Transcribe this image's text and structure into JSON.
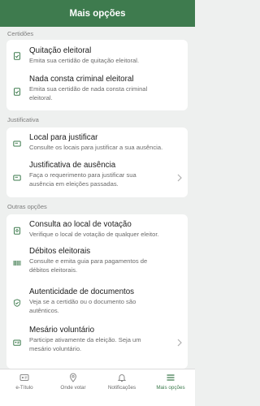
{
  "header": {
    "title": "Mais opções"
  },
  "sections": [
    {
      "label": "Certidões",
      "items": [
        {
          "title": "Quitação eleitoral",
          "icon": "document-check-icon",
          "desc": [
            "Emita sua certidão de quitação eleitoral."
          ]
        },
        {
          "title": "Nada consta criminal eleitoral",
          "icon": "document-check-icon",
          "desc": [
            "Emita sua certidão de nada consta criminal",
            "eleitoral."
          ]
        }
      ]
    },
    {
      "label": "Justificativa",
      "items": [
        {
          "title": "Local para justificar",
          "icon": "message-icon",
          "desc": [
            "Consulte os locais para justificar a sua ausência."
          ]
        },
        {
          "title": "Justificativa de ausência",
          "icon": "message-icon",
          "chevron": true,
          "desc": [
            "Faça o requerimento para justificar sua",
            "ausência em eleições passadas."
          ]
        }
      ]
    },
    {
      "label": "Outras opções",
      "items": [
        {
          "title": "Consulta ao local de votação",
          "icon": "clipboard-location-icon",
          "desc": [
            "Verifique o local de votação de qualquer eleitor."
          ]
        },
        {
          "title": "Débitos eleitorais",
          "icon": "barcode-icon",
          "desc": [
            "Consulte e emita guia para pagamentos de",
            "débitos eleitorais."
          ]
        },
        {
          "title": "Autenticidade de documentos",
          "icon": "shield-check-icon",
          "desc": [
            "Veja se a certidão ou o documento são",
            "autênticos."
          ]
        },
        {
          "title": "Mesário voluntário",
          "icon": "id-card-icon",
          "chevron": true,
          "desc": [
            "Participe ativamente da eleição. Seja um",
            "mesário voluntário."
          ]
        }
      ]
    }
  ],
  "tabbar": [
    {
      "label": "e-Título",
      "icon": "id-card-icon",
      "active": false
    },
    {
      "label": "Onde votar",
      "icon": "location-pin-icon",
      "active": false
    },
    {
      "label": "Notificações",
      "icon": "bell-icon",
      "active": false
    },
    {
      "label": "Mais opções",
      "icon": "menu-icon",
      "active": true
    }
  ],
  "colors": {
    "primary": "#3e7b4e",
    "background": "#eef0ef",
    "card": "#ffffff",
    "title_text": "#1c1c1c",
    "description_text": "#6b6b6b",
    "section_label": "#7d7d7d",
    "chevron": "#b0b0b0",
    "tab_inactive": "#6b6b6b"
  }
}
